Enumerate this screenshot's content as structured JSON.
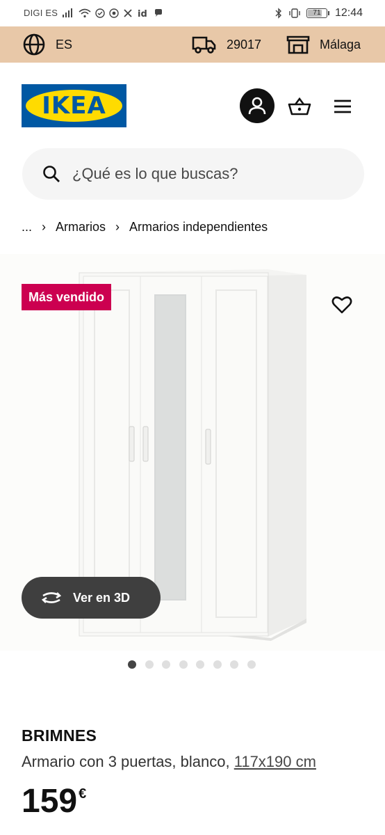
{
  "status_bar": {
    "carrier": "DIGI ES",
    "battery": "71",
    "time": "12:44"
  },
  "location_bar": {
    "language": "ES",
    "postal_code": "29017",
    "store": "Málaga"
  },
  "header": {
    "logo_text": "IKEA",
    "logo_colors": {
      "blue": "#0058a3",
      "yellow": "#ffdb00"
    }
  },
  "search": {
    "placeholder": "¿Qué es lo que buscas?"
  },
  "breadcrumb": {
    "ellipsis": "...",
    "items": [
      "Armarios",
      "Armarios independientes"
    ]
  },
  "product": {
    "badge": "Más vendido",
    "badge_color": "#cc0050",
    "view_3d_label": "Ver en 3D",
    "image_count": 8,
    "active_image": 1,
    "name": "BRIMNES",
    "description": "Armario con 3 puertas, blanco,",
    "dimensions": "117x190 cm",
    "price": "159",
    "currency": "€"
  },
  "accent": {
    "location_bar_bg": "#e8c8a8"
  }
}
